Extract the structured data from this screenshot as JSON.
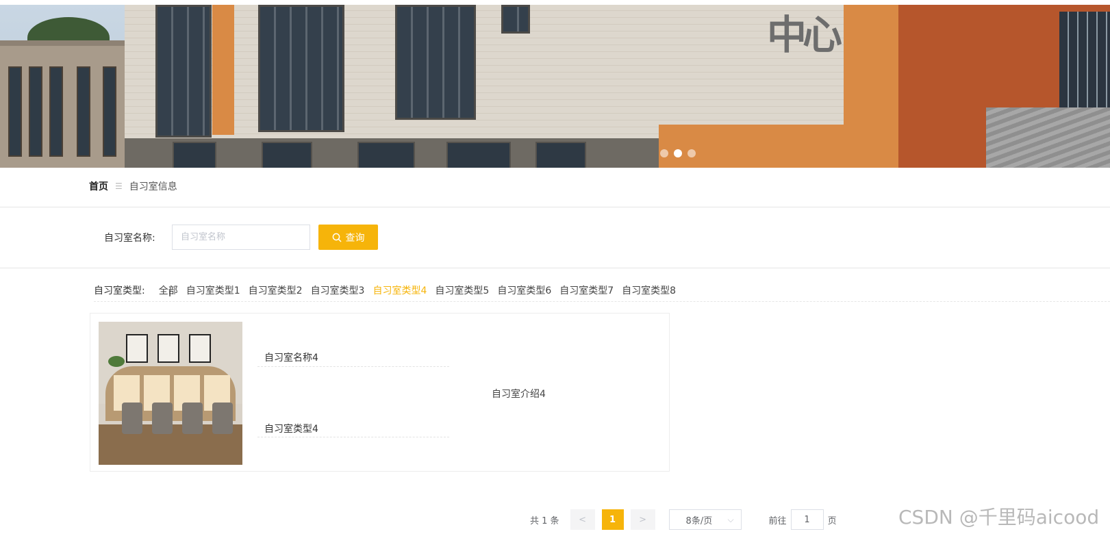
{
  "banner": {
    "sign_text": "中心",
    "carousel": {
      "slide_count": 3,
      "active_index": 1
    }
  },
  "breadcrumb": {
    "home": "首页",
    "separator": "☰",
    "current": "自习室信息"
  },
  "search": {
    "label": "自习室名称:",
    "placeholder": "自习室名称",
    "value": "",
    "button_label": "查询"
  },
  "filter": {
    "label": "自习室类型:",
    "items": [
      "全部",
      "自习室类型1",
      "自习室类型2",
      "自习室类型3",
      "自习室类型4",
      "自习室类型5",
      "自习室类型6",
      "自习室类型7",
      "自习室类型8"
    ],
    "active_index": 4
  },
  "card": {
    "name": "自习室名称4",
    "intro": "自习室介绍4",
    "type": "自习室类型4"
  },
  "pagination": {
    "total": "共 1 条",
    "prev": "<",
    "current_page": "1",
    "next": ">",
    "page_size": "8条/页",
    "goto_label": "前往",
    "goto_value": "1",
    "goto_unit": "页"
  },
  "watermark": "CSDN @千里码aicood",
  "colors": {
    "accent": "#f6b40a",
    "text": "#333333",
    "border": "#dcdfe6"
  }
}
